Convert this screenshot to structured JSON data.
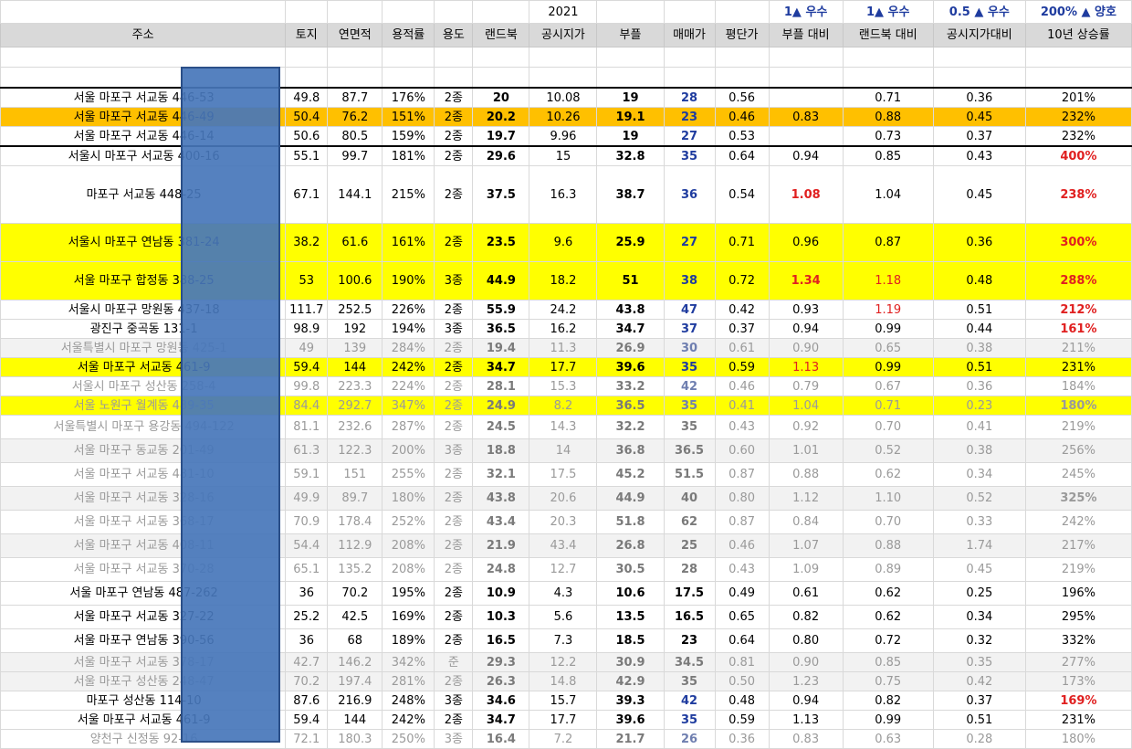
{
  "top_row": {
    "year": "2021",
    "crit_parcel": "1▲ 우수",
    "crit_landbook": "1▲ 우수",
    "crit_official": "0.5 ▲ 우수",
    "crit_rise": "200% ▲ 양호"
  },
  "headers": [
    "주소",
    "토지",
    "연면적",
    "용적률",
    "용도",
    "랜드북",
    "공시지가",
    "부플",
    "매매가",
    "평단가",
    "부플 대비",
    "랜드북 대비",
    "공시지가대비",
    "10년 상승률"
  ],
  "rows": [
    {
      "addr": "서울 마포구 서교동 446-53",
      "land": "49.8",
      "floor": "87.7",
      "far": "176%",
      "use": "2종",
      "lb": "20",
      "off": "10.08",
      "bp": "19",
      "price": "28",
      "ppp": "0.56",
      "vbp": "",
      "vlb": "0.71",
      "voff": "0.36",
      "rise": "201%"
    },
    {
      "addr": "서울 마포구 서교동 446-49",
      "land": "50.4",
      "floor": "76.2",
      "far": "151%",
      "use": "2종",
      "lb": "20.2",
      "off": "10.26",
      "bp": "19.1",
      "price": "23",
      "ppp": "0.46",
      "vbp": "0.83",
      "vlb": "0.88",
      "voff": "0.45",
      "rise": "232%"
    },
    {
      "addr": "서울 마포구 서교동 446-14",
      "land": "50.6",
      "floor": "80.5",
      "far": "159%",
      "use": "2종",
      "lb": "19.7",
      "off": "9.96",
      "bp": "19",
      "price": "27",
      "ppp": "0.53",
      "vbp": "",
      "vlb": "0.73",
      "voff": "0.37",
      "rise": "232%"
    },
    {
      "addr": "서울시 마포구 서교동 400-16",
      "land": "55.1",
      "floor": "99.7",
      "far": "181%",
      "use": "2종",
      "lb": "29.6",
      "off": "15",
      "bp": "32.8",
      "price": "35",
      "ppp": "0.64",
      "vbp": "0.94",
      "vlb": "0.85",
      "voff": "0.43",
      "rise": "400%"
    },
    {
      "addr": "마포구 서교동 448-25",
      "land": "67.1",
      "floor": "144.1",
      "far": "215%",
      "use": "2종",
      "lb": "37.5",
      "off": "16.3",
      "bp": "38.7",
      "price": "36",
      "ppp": "0.54",
      "vbp": "1.08",
      "vlb": "1.04",
      "voff": "0.45",
      "rise": "238%"
    },
    {
      "addr": "서울시 마포구 연남동 381-24",
      "land": "38.2",
      "floor": "61.6",
      "far": "161%",
      "use": "2종",
      "lb": "23.5",
      "off": "9.6",
      "bp": "25.9",
      "price": "27",
      "ppp": "0.71",
      "vbp": "0.96",
      "vlb": "0.87",
      "voff": "0.36",
      "rise": "300%"
    },
    {
      "addr": "서울 마포구 합정동 388-25",
      "land": "53",
      "floor": "100.6",
      "far": "190%",
      "use": "3종",
      "lb": "44.9",
      "off": "18.2",
      "bp": "51",
      "price": "38",
      "ppp": "0.72",
      "vbp": "1.34",
      "vlb": "1.18",
      "voff": "0.48",
      "rise": "288%"
    },
    {
      "addr": "서울시 마포구 망원동 437-18",
      "land": "111.7",
      "floor": "252.5",
      "far": "226%",
      "use": "2종",
      "lb": "55.9",
      "off": "24.2",
      "bp": "43.8",
      "price": "47",
      "ppp": "0.42",
      "vbp": "0.93",
      "vlb": "1.19",
      "voff": "0.51",
      "rise": "212%"
    },
    {
      "addr": "광진구 중곡동 131-1",
      "land": "98.9",
      "floor": "192",
      "far": "194%",
      "use": "3종",
      "lb": "36.5",
      "off": "16.2",
      "bp": "34.7",
      "price": "37",
      "ppp": "0.37",
      "vbp": "0.94",
      "vlb": "0.99",
      "voff": "0.44",
      "rise": "161%"
    },
    {
      "addr": "서울특별시 마포구 망원동 425-1",
      "land": "49",
      "floor": "139",
      "far": "284%",
      "use": "2종",
      "lb": "19.4",
      "off": "11.3",
      "bp": "26.9",
      "price": "30",
      "ppp": "0.61",
      "vbp": "0.90",
      "vlb": "0.65",
      "voff": "0.38",
      "rise": "211%"
    },
    {
      "addr": "서울 마포구 서교동 461-9",
      "land": "59.4",
      "floor": "144",
      "far": "242%",
      "use": "2종",
      "lb": "34.7",
      "off": "17.7",
      "bp": "39.6",
      "price": "35",
      "ppp": "0.59",
      "vbp": "1.13",
      "vlb": "0.99",
      "voff": "0.51",
      "rise": "231%"
    },
    {
      "addr": "서울시 마포구 성산동 258-4",
      "land": "99.8",
      "floor": "223.3",
      "far": "224%",
      "use": "2종",
      "lb": "28.1",
      "off": "15.3",
      "bp": "33.2",
      "price": "42",
      "ppp": "0.46",
      "vbp": "0.79",
      "vlb": "0.67",
      "voff": "0.36",
      "rise": "184%"
    },
    {
      "addr": "서울 노원구 월계동 489-35",
      "land": "84.4",
      "floor": "292.7",
      "far": "347%",
      "use": "2종",
      "lb": "24.9",
      "off": "8.2",
      "bp": "36.5",
      "price": "35",
      "ppp": "0.41",
      "vbp": "1.04",
      "vlb": "0.71",
      "voff": "0.23",
      "rise": "180%"
    },
    {
      "addr": "서울특별시 마포구 용강동 494-122",
      "land": "81.1",
      "floor": "232.6",
      "far": "287%",
      "use": "2종",
      "lb": "24.5",
      "off": "14.3",
      "bp": "32.2",
      "price": "35",
      "ppp": "0.43",
      "vbp": "0.92",
      "vlb": "0.70",
      "voff": "0.41",
      "rise": "219%"
    },
    {
      "addr": "서울 마포구 동교동 201-49",
      "land": "61.3",
      "floor": "122.3",
      "far": "200%",
      "use": "3종",
      "lb": "18.8",
      "off": "14",
      "bp": "36.8",
      "price": "36.5",
      "ppp": "0.60",
      "vbp": "1.01",
      "vlb": "0.52",
      "voff": "0.38",
      "rise": "256%"
    },
    {
      "addr": "서울 마포구 서교동 481-10",
      "land": "59.1",
      "floor": "151",
      "far": "255%",
      "use": "2종",
      "lb": "32.1",
      "off": "17.5",
      "bp": "45.2",
      "price": "51.5",
      "ppp": "0.87",
      "vbp": "0.88",
      "vlb": "0.62",
      "voff": "0.34",
      "rise": "245%"
    },
    {
      "addr": "서울 마포구 서교동 328-16",
      "land": "49.9",
      "floor": "89.7",
      "far": "180%",
      "use": "2종",
      "lb": "43.8",
      "off": "20.6",
      "bp": "44.9",
      "price": "40",
      "ppp": "0.80",
      "vbp": "1.12",
      "vlb": "1.10",
      "voff": "0.52",
      "rise": "325%"
    },
    {
      "addr": "서울 마포구 서교동 368-17",
      "land": "70.9",
      "floor": "178.4",
      "far": "252%",
      "use": "2종",
      "lb": "43.4",
      "off": "20.3",
      "bp": "51.8",
      "price": "62",
      "ppp": "0.87",
      "vbp": "0.84",
      "vlb": "0.70",
      "voff": "0.33",
      "rise": "242%"
    },
    {
      "addr": "서울 마포구 서교동 408-11",
      "land": "54.4",
      "floor": "112.9",
      "far": "208%",
      "use": "2종",
      "lb": "21.9",
      "off": "43.4",
      "bp": "26.8",
      "price": "25",
      "ppp": "0.46",
      "vbp": "1.07",
      "vlb": "0.88",
      "voff": "1.74",
      "rise": "217%"
    },
    {
      "addr": "서울 마포구 서교동 370-28",
      "land": "65.1",
      "floor": "135.2",
      "far": "208%",
      "use": "2종",
      "lb": "24.8",
      "off": "12.7",
      "bp": "30.5",
      "price": "28",
      "ppp": "0.43",
      "vbp": "1.09",
      "vlb": "0.89",
      "voff": "0.45",
      "rise": "219%"
    },
    {
      "addr": "서울 마포구 연남동 487-262",
      "land": "36",
      "floor": "70.2",
      "far": "195%",
      "use": "2종",
      "lb": "10.9",
      "off": "4.3",
      "bp": "10.6",
      "price": "17.5",
      "ppp": "0.49",
      "vbp": "0.61",
      "vlb": "0.62",
      "voff": "0.25",
      "rise": "196%"
    },
    {
      "addr": "서울 마포구 서교동 327-22",
      "land": "25.2",
      "floor": "42.5",
      "far": "169%",
      "use": "2종",
      "lb": "10.3",
      "off": "5.6",
      "bp": "13.5",
      "price": "16.5",
      "ppp": "0.65",
      "vbp": "0.82",
      "vlb": "0.62",
      "voff": "0.34",
      "rise": "295%"
    },
    {
      "addr": "서울 마포구 연남동 390-56",
      "land": "36",
      "floor": "68",
      "far": "189%",
      "use": "2종",
      "lb": "16.5",
      "off": "7.3",
      "bp": "18.5",
      "price": "23",
      "ppp": "0.64",
      "vbp": "0.80",
      "vlb": "0.72",
      "voff": "0.32",
      "rise": "332%"
    },
    {
      "addr": "서울 마포구 서교동 378-17",
      "land": "42.7",
      "floor": "146.2",
      "far": "342%",
      "use": "준",
      "lb": "29.3",
      "off": "12.2",
      "bp": "30.9",
      "price": "34.5",
      "ppp": "0.81",
      "vbp": "0.90",
      "vlb": "0.85",
      "voff": "0.35",
      "rise": "277%"
    },
    {
      "addr": "서울 마포구 성산동 248-47",
      "land": "70.2",
      "floor": "197.4",
      "far": "281%",
      "use": "2종",
      "lb": "26.3",
      "off": "14.8",
      "bp": "42.9",
      "price": "35",
      "ppp": "0.50",
      "vbp": "1.23",
      "vlb": "0.75",
      "voff": "0.42",
      "rise": "173%"
    },
    {
      "addr": "마포구 성산동 114-10",
      "land": "87.6",
      "floor": "216.9",
      "far": "248%",
      "use": "3종",
      "lb": "34.6",
      "off": "15.7",
      "bp": "39.3",
      "price": "42",
      "ppp": "0.48",
      "vbp": "0.94",
      "vlb": "0.82",
      "voff": "0.37",
      "rise": "169%"
    },
    {
      "addr": "서울 마포구 서교동 461-9",
      "land": "59.4",
      "floor": "144",
      "far": "242%",
      "use": "2종",
      "lb": "34.7",
      "off": "17.7",
      "bp": "39.6",
      "price": "35",
      "ppp": "0.59",
      "vbp": "1.13",
      "vlb": "0.99",
      "voff": "0.51",
      "rise": "231%"
    },
    {
      "addr": "양천구 신정동 92-16",
      "land": "72.1",
      "floor": "180.3",
      "far": "250%",
      "use": "3종",
      "lb": "16.4",
      "off": "7.2",
      "bp": "21.7",
      "price": "26",
      "ppp": "0.36",
      "vbp": "0.83",
      "vlb": "0.63",
      "voff": "0.28",
      "rise": "180%"
    }
  ],
  "colors": {
    "header_bg": "#d9d9d9",
    "highlight_orange": "#ffc000",
    "highlight_yellow": "#ffff00",
    "band_grey": "#f2f2f2",
    "criteria_blue": "#1f3c9f",
    "alert_red": "#e02020",
    "overlay_blue": "#4676ba"
  }
}
